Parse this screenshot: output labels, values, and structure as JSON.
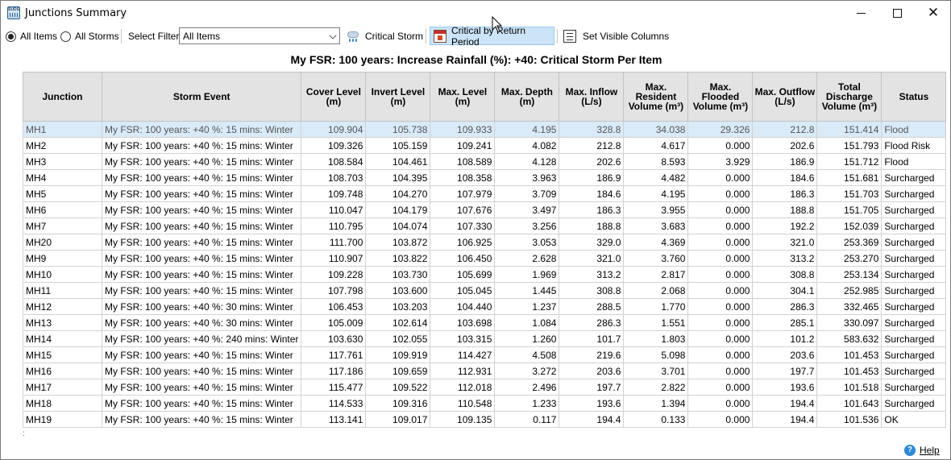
{
  "window": {
    "title": "Junctions Summary",
    "app_icon_text": "SUDS"
  },
  "toolbar": {
    "all_items_label": "All Items",
    "all_storms_label": "All Storms",
    "select_filter_label": "Select Filter",
    "filter_value": "All Items",
    "critical_storm_label": "Critical Storm",
    "critical_return_label": "Critical by Return Period",
    "visible_columns_label": "Set Visible Columns"
  },
  "report": {
    "title": "My FSR: 100 years: Increase Rainfall (%): +40: Critical Storm Per Item"
  },
  "table": {
    "columns": [
      "Junction",
      "Storm Event",
      "Cover Level (m)",
      "Invert Level (m)",
      "Max. Level (m)",
      "Max. Depth (m)",
      "Max. Inflow (L/s)",
      "Max. Resident Volume (m³)",
      "Max. Flooded Volume (m³)",
      "Max. Outflow (L/s)",
      "Total Discharge Volume (m³)",
      "Status"
    ],
    "rows": [
      [
        "MH1",
        "My FSR: 100 years: +40 %: 15 mins: Winter",
        "109.904",
        "105.738",
        "109.933",
        "4.195",
        "328.8",
        "34.038",
        "29.326",
        "212.8",
        "151.414",
        "Flood"
      ],
      [
        "MH2",
        "My FSR: 100 years: +40 %: 15 mins: Winter",
        "109.326",
        "105.159",
        "109.241",
        "4.082",
        "212.8",
        "4.617",
        "0.000",
        "202.6",
        "151.793",
        "Flood Risk"
      ],
      [
        "MH3",
        "My FSR: 100 years: +40 %: 15 mins: Winter",
        "108.584",
        "104.461",
        "108.589",
        "4.128",
        "202.6",
        "8.593",
        "3.929",
        "186.9",
        "151.712",
        "Flood"
      ],
      [
        "MH4",
        "My FSR: 100 years: +40 %: 15 mins: Winter",
        "108.703",
        "104.395",
        "108.358",
        "3.963",
        "186.9",
        "4.482",
        "0.000",
        "184.6",
        "151.681",
        "Surcharged"
      ],
      [
        "MH5",
        "My FSR: 100 years: +40 %: 15 mins: Winter",
        "109.748",
        "104.270",
        "107.979",
        "3.709",
        "184.6",
        "4.195",
        "0.000",
        "186.3",
        "151.703",
        "Surcharged"
      ],
      [
        "MH6",
        "My FSR: 100 years: +40 %: 15 mins: Winter",
        "110.047",
        "104.179",
        "107.676",
        "3.497",
        "186.3",
        "3.955",
        "0.000",
        "188.8",
        "151.705",
        "Surcharged"
      ],
      [
        "MH7",
        "My FSR: 100 years: +40 %: 15 mins: Winter",
        "110.795",
        "104.074",
        "107.330",
        "3.256",
        "188.8",
        "3.683",
        "0.000",
        "192.2",
        "152.039",
        "Surcharged"
      ],
      [
        "MH20",
        "My FSR: 100 years: +40 %: 15 mins: Winter",
        "111.700",
        "103.872",
        "106.925",
        "3.053",
        "329.0",
        "4.369",
        "0.000",
        "321.0",
        "253.369",
        "Surcharged"
      ],
      [
        "MH9",
        "My FSR: 100 years: +40 %: 15 mins: Winter",
        "110.907",
        "103.822",
        "106.450",
        "2.628",
        "321.0",
        "3.760",
        "0.000",
        "313.2",
        "253.270",
        "Surcharged"
      ],
      [
        "MH10",
        "My FSR: 100 years: +40 %: 15 mins: Winter",
        "109.228",
        "103.730",
        "105.699",
        "1.969",
        "313.2",
        "2.817",
        "0.000",
        "308.8",
        "253.134",
        "Surcharged"
      ],
      [
        "MH11",
        "My FSR: 100 years: +40 %: 15 mins: Winter",
        "107.798",
        "103.600",
        "105.045",
        "1.445",
        "308.8",
        "2.068",
        "0.000",
        "304.1",
        "252.985",
        "Surcharged"
      ],
      [
        "MH12",
        "My FSR: 100 years: +40 %: 30 mins: Winter",
        "106.453",
        "103.203",
        "104.440",
        "1.237",
        "288.5",
        "1.770",
        "0.000",
        "286.3",
        "332.465",
        "Surcharged"
      ],
      [
        "MH13",
        "My FSR: 100 years: +40 %: 30 mins: Winter",
        "105.009",
        "102.614",
        "103.698",
        "1.084",
        "286.3",
        "1.551",
        "0.000",
        "285.1",
        "330.097",
        "Surcharged"
      ],
      [
        "MH14",
        "My FSR: 100 years: +40 %: 240 mins: Winter",
        "103.630",
        "102.055",
        "103.315",
        "1.260",
        "101.7",
        "1.803",
        "0.000",
        "101.2",
        "583.632",
        "Surcharged"
      ],
      [
        "MH15",
        "My FSR: 100 years: +40 %: 15 mins: Winter",
        "117.761",
        "109.919",
        "114.427",
        "4.508",
        "219.6",
        "5.098",
        "0.000",
        "203.6",
        "101.453",
        "Surcharged"
      ],
      [
        "MH16",
        "My FSR: 100 years: +40 %: 15 mins: Winter",
        "117.186",
        "109.659",
        "112.931",
        "3.272",
        "203.6",
        "3.701",
        "0.000",
        "197.7",
        "101.453",
        "Surcharged"
      ],
      [
        "MH17",
        "My FSR: 100 years: +40 %: 15 mins: Winter",
        "115.477",
        "109.522",
        "112.018",
        "2.496",
        "197.7",
        "2.822",
        "0.000",
        "193.6",
        "101.518",
        "Surcharged"
      ],
      [
        "MH18",
        "My FSR: 100 years: +40 %: 15 mins: Winter",
        "114.533",
        "109.316",
        "110.548",
        "1.233",
        "193.6",
        "1.394",
        "0.000",
        "194.4",
        "101.643",
        "Surcharged"
      ],
      [
        "MH19",
        "My FSR: 100 years: +40 %: 15 mins: Winter",
        "113.141",
        "109.017",
        "109.135",
        "0.117",
        "194.4",
        "0.133",
        "0.000",
        "194.4",
        "101.536",
        "OK"
      ]
    ]
  },
  "footer": {
    "help_label": "Help",
    "help_icon_text": "?"
  },
  "icons": {
    "app": "app-grid-icon",
    "storm": "storm-cloud-icon",
    "calendar": "calendar-icon",
    "columns": "column-list-icon",
    "help": "help-icon"
  }
}
